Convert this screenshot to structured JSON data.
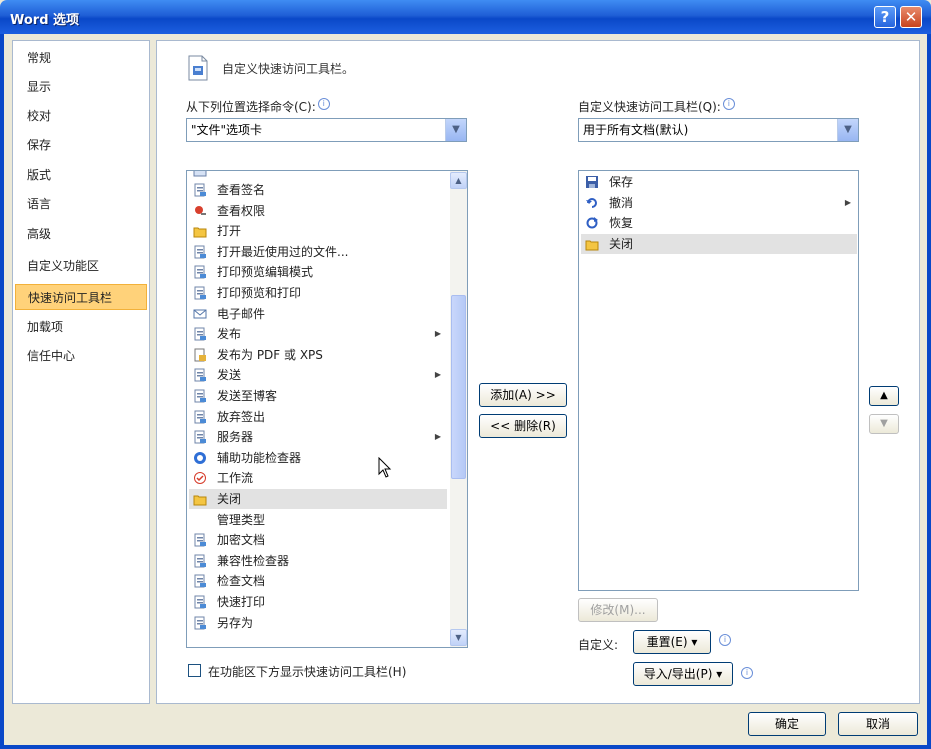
{
  "window": {
    "title": "Word 选项",
    "help_glyph": "?",
    "close_glyph": "✕"
  },
  "nav": {
    "items": [
      {
        "label": "常规"
      },
      {
        "label": "显示"
      },
      {
        "label": "校对"
      },
      {
        "label": "保存"
      },
      {
        "label": "版式"
      },
      {
        "label": "语言"
      },
      {
        "label": "高级"
      },
      {
        "label": "自定义功能区"
      },
      {
        "label": "快速访问工具栏",
        "selected": true
      },
      {
        "label": "加载项"
      },
      {
        "label": "信任中心"
      }
    ]
  },
  "main": {
    "heading": "自定义快速访问工具栏。",
    "choose_label": "从下列位置选择命令(C):",
    "choose_value": "\"文件\"选项卡",
    "customize_label": "自定义快速访问工具栏(Q):",
    "customize_value": "用于所有文档(默认)",
    "commands": [
      {
        "label": "查看签名",
        "icon": "signature-icon"
      },
      {
        "label": "查看权限",
        "icon": "permission-icon"
      },
      {
        "label": "打开",
        "icon": "folder-open-icon"
      },
      {
        "label": "打开最近使用过的文件...",
        "icon": "recent-files-icon"
      },
      {
        "label": "打印预览编辑模式",
        "icon": "print-preview-edit-icon"
      },
      {
        "label": "打印预览和打印",
        "icon": "print-preview-icon"
      },
      {
        "label": "电子邮件",
        "icon": "email-icon"
      },
      {
        "label": "发布",
        "icon": "publish-icon",
        "submenu": true
      },
      {
        "label": "发布为 PDF 或 XPS",
        "icon": "pdf-icon"
      },
      {
        "label": "发送",
        "icon": "send-icon",
        "submenu": true
      },
      {
        "label": "发送至博客",
        "icon": "blog-icon"
      },
      {
        "label": "放弃签出",
        "icon": "discard-checkout-icon"
      },
      {
        "label": "服务器",
        "icon": "server-icon",
        "submenu": true
      },
      {
        "label": "辅助功能检查器",
        "icon": "accessibility-icon"
      },
      {
        "label": "工作流",
        "icon": "workflow-icon"
      },
      {
        "label": "关闭",
        "icon": "close-folder-icon",
        "selected": true
      },
      {
        "label": "管理类型",
        "icon": ""
      },
      {
        "label": "加密文档",
        "icon": "encrypt-icon"
      },
      {
        "label": "兼容性检查器",
        "icon": "compat-check-icon"
      },
      {
        "label": "检查文档",
        "icon": "inspect-icon"
      },
      {
        "label": "快速打印",
        "icon": "quick-print-icon"
      },
      {
        "label": "另存为",
        "icon": "save-as-icon"
      }
    ],
    "toolbar_items": [
      {
        "label": "保存",
        "icon": "save-icon"
      },
      {
        "label": "撤消",
        "icon": "undo-icon",
        "submenu": true
      },
      {
        "label": "恢复",
        "icon": "redo-icon"
      },
      {
        "label": "关闭",
        "icon": "close-folder-icon",
        "selected": true
      }
    ],
    "add_button": "添加(A) >>",
    "remove_button": "<< 删除(R)",
    "move_up": "▲",
    "move_down": "▼",
    "modify_button": "修改(M)...",
    "customize_label2": "自定义:",
    "reset_button": "重置(E) ▾",
    "import_export_button": "导入/导出(P) ▾",
    "show_below_label": "在功能区下方显示快速访问工具栏(H)"
  },
  "footer": {
    "ok": "确定",
    "cancel": "取消"
  }
}
